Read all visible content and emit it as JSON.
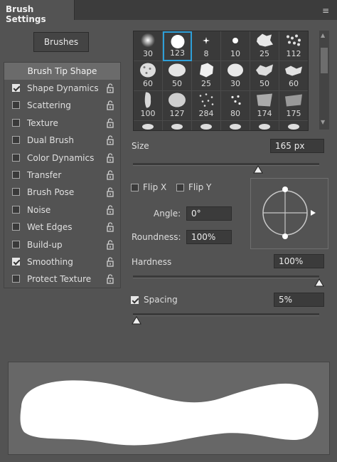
{
  "panel": {
    "title": "Brush Settings",
    "menu_icon": "hamburger-menu-icon"
  },
  "brushes_button": "Brushes",
  "sidebar": {
    "active_item": "Brush Tip Shape",
    "options": [
      {
        "label": "Shape Dynamics",
        "checked": true
      },
      {
        "label": "Scattering",
        "checked": false
      },
      {
        "label": "Texture",
        "checked": false
      },
      {
        "label": "Dual Brush",
        "checked": false
      },
      {
        "label": "Color Dynamics",
        "checked": false
      },
      {
        "label": "Transfer",
        "checked": false
      },
      {
        "label": "Brush Pose",
        "checked": false
      },
      {
        "label": "Noise",
        "checked": false
      },
      {
        "label": "Wet Edges",
        "checked": false
      },
      {
        "label": "Build-up",
        "checked": false
      },
      {
        "label": "Smoothing",
        "checked": true
      },
      {
        "label": "Protect Texture",
        "checked": false
      }
    ]
  },
  "brush_grid": {
    "selected_index": 1,
    "sizes": [
      "30",
      "123",
      "8",
      "10",
      "25",
      "112",
      "60",
      "50",
      "25",
      "30",
      "50",
      "60",
      "100",
      "127",
      "284",
      "80",
      "174",
      "175"
    ]
  },
  "size": {
    "label": "Size",
    "value": "165 px",
    "slider_fraction": 0.67
  },
  "flip_x": {
    "label": "Flip X",
    "checked": false
  },
  "flip_y": {
    "label": "Flip Y",
    "checked": false
  },
  "angle": {
    "label": "Angle:",
    "value": "0°"
  },
  "roundness": {
    "label": "Roundness:",
    "value": "100%"
  },
  "hardness": {
    "label": "Hardness",
    "value": "100%",
    "slider_fraction": 1.0
  },
  "spacing": {
    "label": "Spacing",
    "value": "5%",
    "checked": true,
    "slider_fraction": 0.02
  },
  "colors": {
    "selection_accent": "#2e9fd8",
    "panel_bg": "#535353"
  }
}
